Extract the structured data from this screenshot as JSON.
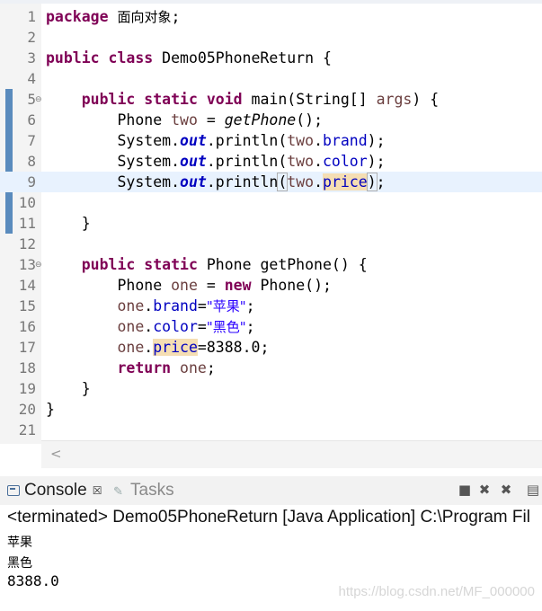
{
  "editor": {
    "line_numbers": [
      "1",
      "2",
      "3",
      "4",
      "5",
      "6",
      "7",
      "8",
      "9",
      "10",
      "11",
      "12",
      "13",
      "14",
      "15",
      "16",
      "17",
      "18",
      "19",
      "20",
      "21"
    ],
    "fold_marker": "⊖",
    "tokens": {
      "package": "package",
      "package_name": "面向对象",
      "semicolon": ";",
      "public": "public",
      "class": "class",
      "class_name": "Demo05PhoneReturn",
      "open_brace": "{",
      "close_brace": "}",
      "static": "static",
      "void": "void",
      "main_sig": "main(String[] ",
      "args": "args",
      "main_tail": ") {",
      "phone_type": "Phone ",
      "two": "two",
      "assign": " = ",
      "get_phone": "getPhone",
      "call_tail": "();",
      "system": "System.",
      "out": "out",
      "println_open": ".println(",
      "dot": ".",
      "brand": "brand",
      "color": "color",
      "price": "price",
      "println_close": ");",
      "paren_open": "(",
      "paren_close": ")",
      "get_phone_sig": "Phone getPhone() {",
      "one": "one",
      "new": "new",
      "new_tail": " Phone();",
      "eq": "=",
      "brand_value": "\"苹果\"",
      "color_value": "\"黑色\"",
      "price_value": "=8388.0;",
      "return": "return"
    }
  },
  "console": {
    "tab_label": "Console",
    "close_glyph": "☒",
    "tasks_label": "Tasks",
    "terminated_line": "<terminated> Demo05PhoneReturn [Java Application] C:\\Program Fil",
    "output_lines": [
      "苹果",
      "黑色",
      "8388.0"
    ],
    "toolbar": {
      "stop_glyph": "■",
      "remove_glyph": "✖",
      "remove_all_glyph": "✖",
      "clear_glyph": "▤"
    }
  },
  "watermark": "https://blog.csdn.net/MF_000000"
}
